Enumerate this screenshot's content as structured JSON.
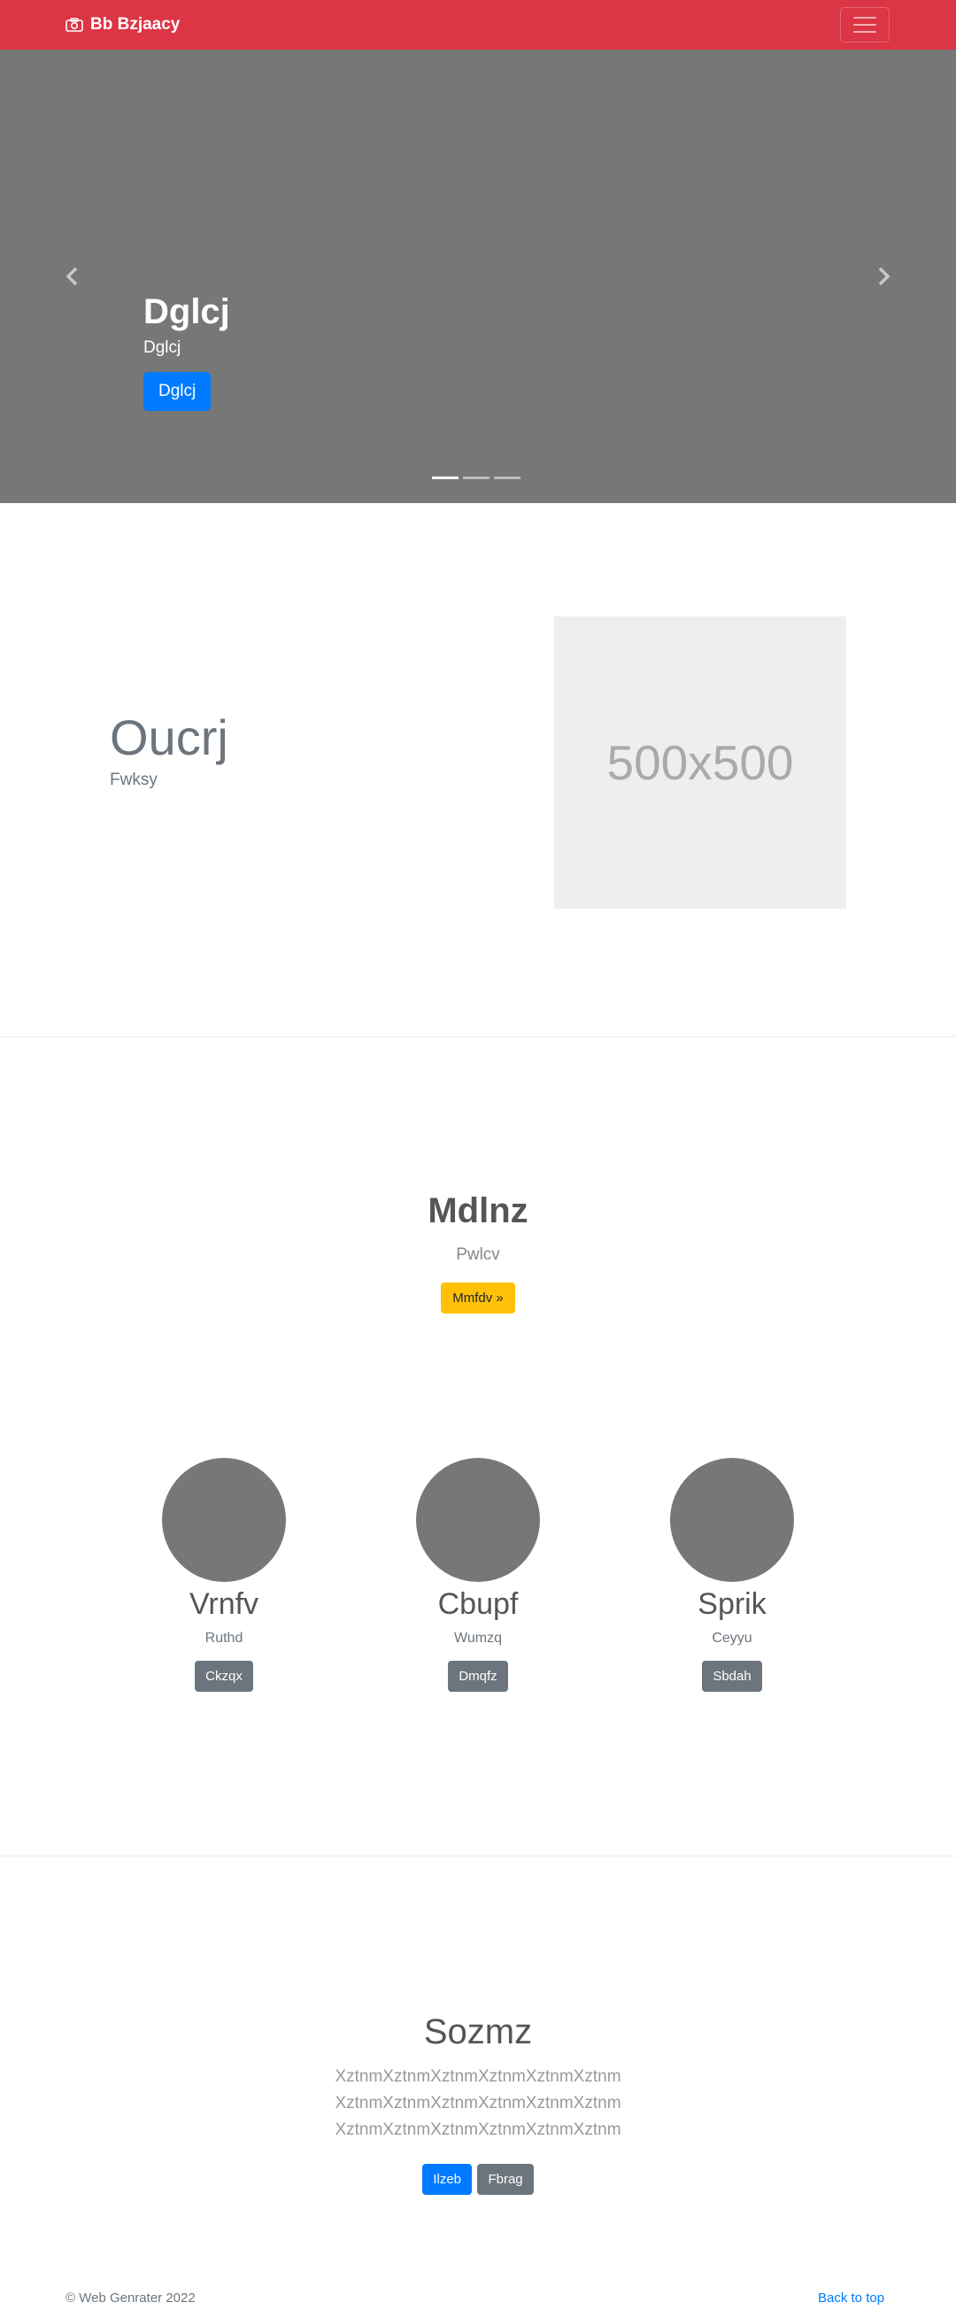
{
  "navbar": {
    "brand": "Bb Bzjaacy",
    "brand_color": "#dc3545"
  },
  "carousel": {
    "title": "Dglcj",
    "text": "Dglcj",
    "button": "Dglcj",
    "slides_count": 3,
    "active_slide": 1
  },
  "feature": {
    "title": "Oucrj",
    "subtitle": "Fwksy",
    "placeholder": "500x500"
  },
  "highlight": {
    "title": "Mdlnz",
    "subtitle": "Pwlcv",
    "button": "Mmfdv »"
  },
  "columns": [
    {
      "title": "Vrnfv",
      "subtitle": "Ruthd",
      "button": "Ckzqx"
    },
    {
      "title": "Cbupf",
      "subtitle": "Wumzq",
      "button": "Dmqfz"
    },
    {
      "title": "Sprik",
      "subtitle": "Ceyyu",
      "button": "Sbdah"
    }
  ],
  "bottom": {
    "title": "Sozmz",
    "lines": [
      "XztnmXztnmXztnmXztnmXztnmXztnm",
      "XztnmXztnmXztnmXztnmXztnmXztnm",
      "XztnmXztnmXztnmXztnmXztnmXztnm"
    ],
    "primary_button": "Ilzeb",
    "secondary_button": "Fbrag"
  },
  "footer": {
    "copyright": "© Web Genrater 2022",
    "back_to_top": "Back to top"
  }
}
